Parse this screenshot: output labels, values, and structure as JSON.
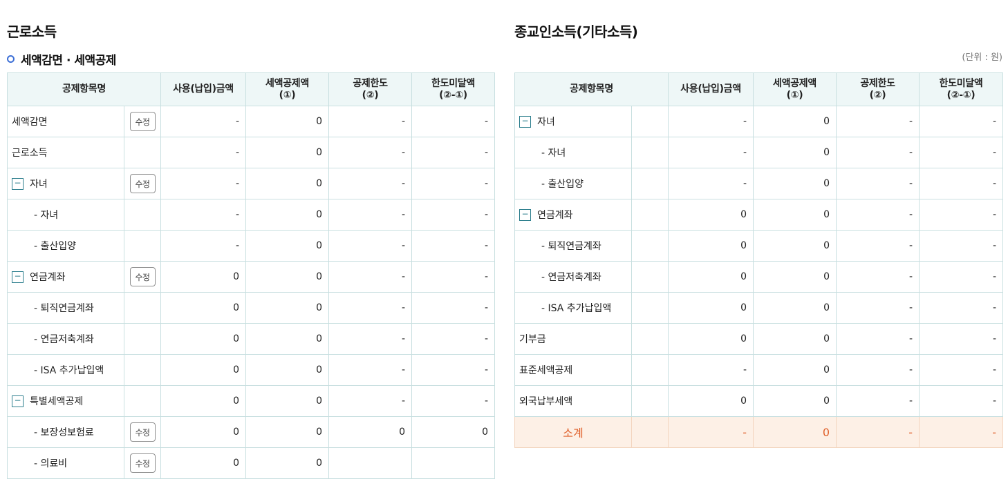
{
  "left": {
    "title": "근로소득",
    "subtitle": "세액감면 · 세액공제",
    "headers": {
      "name": "공제항목명",
      "col1": [
        "사용(납입)금액"
      ],
      "col2": [
        "세액공제액",
        "(①)"
      ],
      "col3": [
        "공제한도",
        "(②)"
      ],
      "col4": [
        "한도미달액",
        "(②-①)"
      ]
    },
    "edit_label": "수정",
    "collapse_symbol": "−",
    "rows": [
      {
        "label": "세액감면",
        "amount": "-",
        "credit": "0",
        "limit": "-",
        "shortfall": "-"
      },
      {
        "label": "근로소득",
        "amount": "-",
        "credit": "0",
        "limit": "-",
        "shortfall": "-"
      },
      {
        "label": "자녀",
        "amount": "-",
        "credit": "0",
        "limit": "-",
        "shortfall": "-"
      },
      {
        "label": "- 자녀",
        "amount": "-",
        "credit": "0",
        "limit": "-",
        "shortfall": "-"
      },
      {
        "label": "- 출산입양",
        "amount": "-",
        "credit": "0",
        "limit": "-",
        "shortfall": "-"
      },
      {
        "label": "연금계좌",
        "amount": "0",
        "credit": "0",
        "limit": "-",
        "shortfall": "-"
      },
      {
        "label": "- 퇴직연금계좌",
        "amount": "0",
        "credit": "0",
        "limit": "-",
        "shortfall": "-"
      },
      {
        "label": "- 연금저축계좌",
        "amount": "0",
        "credit": "0",
        "limit": "-",
        "shortfall": "-"
      },
      {
        "label": "- ISA 추가납입액",
        "amount": "0",
        "credit": "0",
        "limit": "-",
        "shortfall": "-"
      },
      {
        "label": "특별세액공제",
        "amount": "0",
        "credit": "0",
        "limit": "-",
        "shortfall": "-"
      },
      {
        "label": "- 보장성보험료",
        "amount": "0",
        "credit": "0",
        "limit": "0",
        "shortfall": "0"
      },
      {
        "label": "- 의료비",
        "amount": "0",
        "credit": "0",
        "limit": "",
        "shortfall": ""
      }
    ]
  },
  "right": {
    "title": "종교인소득(기타소득)",
    "unit": "(단위 : 원)",
    "headers": {
      "name": "공제항목명",
      "col1": [
        "사용(납입)금액"
      ],
      "col2": [
        "세액공제액",
        "(①)"
      ],
      "col3": [
        "공제한도",
        "(②)"
      ],
      "col4": [
        "한도미달액",
        "(②-①)"
      ]
    },
    "collapse_symbol": "−",
    "rows": [
      {
        "label": "자녀",
        "amount": "-",
        "credit": "0",
        "limit": "-",
        "shortfall": "-"
      },
      {
        "label": "- 자녀",
        "amount": "-",
        "credit": "0",
        "limit": "-",
        "shortfall": "-"
      },
      {
        "label": "- 출산입양",
        "amount": "-",
        "credit": "0",
        "limit": "-",
        "shortfall": "-"
      },
      {
        "label": "연금계좌",
        "amount": "0",
        "credit": "0",
        "limit": "-",
        "shortfall": "-"
      },
      {
        "label": "- 퇴직연금계좌",
        "amount": "0",
        "credit": "0",
        "limit": "-",
        "shortfall": "-"
      },
      {
        "label": "- 연금저축계좌",
        "amount": "0",
        "credit": "0",
        "limit": "-",
        "shortfall": "-"
      },
      {
        "label": "- ISA 추가납입액",
        "amount": "0",
        "credit": "0",
        "limit": "-",
        "shortfall": "-"
      },
      {
        "label": "기부금",
        "amount": "0",
        "credit": "0",
        "limit": "-",
        "shortfall": "-"
      },
      {
        "label": "표준세액공제",
        "amount": "-",
        "credit": "0",
        "limit": "-",
        "shortfall": "-"
      },
      {
        "label": "외국납부세액",
        "amount": "0",
        "credit": "0",
        "limit": "-",
        "shortfall": "-"
      }
    ],
    "subtotal": {
      "label": "소계",
      "amount": "-",
      "credit": "0",
      "limit": "-",
      "shortfall": "-"
    }
  }
}
